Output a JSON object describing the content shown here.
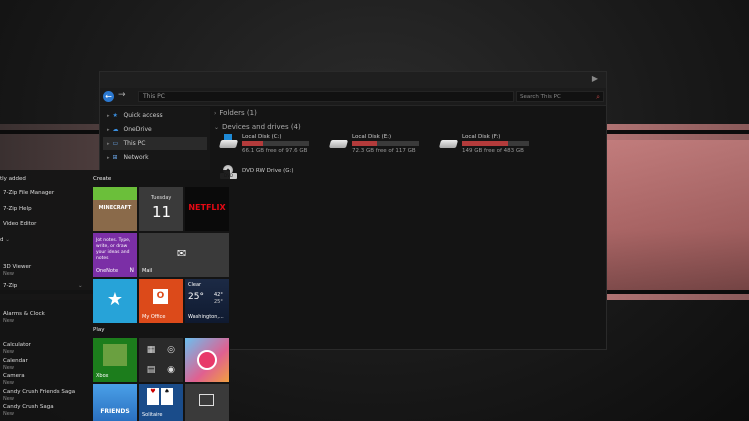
{
  "explorer": {
    "address": "This PC",
    "search_placeholder": "Search This PC",
    "nav": [
      {
        "label": "Quick access",
        "icon": "star-icon"
      },
      {
        "label": "OneDrive",
        "icon": "cloud-icon"
      },
      {
        "label": "This PC",
        "icon": "computer-icon"
      },
      {
        "label": "Network",
        "icon": "network-icon"
      }
    ],
    "folders_header": "Folders (1)",
    "devices_header": "Devices and drives (4)",
    "drives": [
      {
        "name": "Local Disk (C:)",
        "free": "66.1 GB free of 97.6 GB",
        "used_fraction": 0.32
      },
      {
        "name": "Local Disk (E:)",
        "free": "72.3 GB free of 117 GB",
        "used_fraction": 0.38
      },
      {
        "name": "Local Disk (F:)",
        "free": "149 GB free of 483 GB",
        "used_fraction": 0.69
      }
    ],
    "dvd": {
      "name": "DVD RW Drive (G:)",
      "icon_text": "DVD"
    }
  },
  "start": {
    "recently_added": "tly added",
    "apps": [
      "7-Zip File Manager",
      "7-Zip Help",
      "Video Editor",
      "d",
      "3D Viewer",
      "7-Zip",
      "Alarms & Clock",
      "Calculator",
      "Calendar",
      "Camera",
      "Candy Crush Friends Saga",
      "Candy Crush Saga"
    ],
    "new_label": "New",
    "create_header": "Create",
    "play_header": "Play",
    "tiles": {
      "minecraft": "MINECRAFT",
      "calendar_day": "Tuesday",
      "calendar_date": "11",
      "netflix": "NETFLIX",
      "onenote_text": "Jot notes. Type, write, or draw your ideas and notes",
      "onenote_label": "OneNote",
      "mail_label": "Mail",
      "myoffice_label": "My Office",
      "weather_cond": "Clear",
      "weather_temp": "25°",
      "weather_hi": "42°",
      "weather_lo": "25°",
      "weather_city": "Washington,...",
      "xbox_label": "Xbox",
      "friends": "FRIENDS",
      "solitaire_label": "Solitaire"
    }
  }
}
